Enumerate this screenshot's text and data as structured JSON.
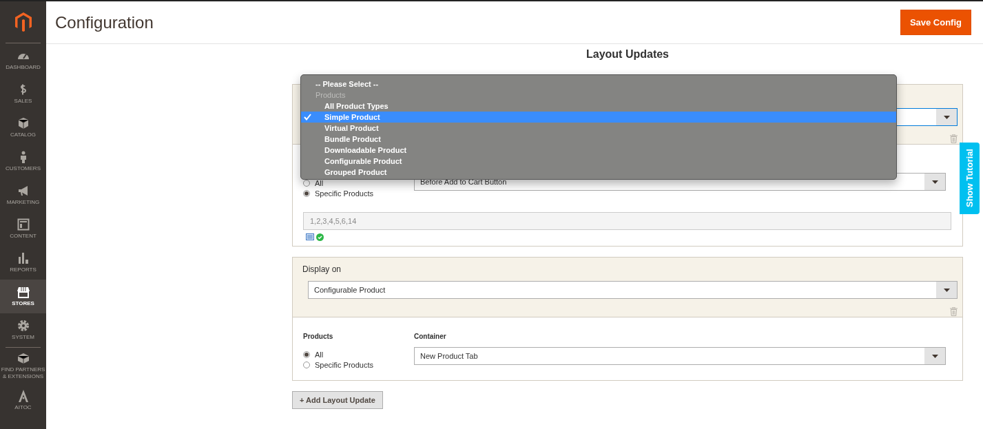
{
  "sidebar": {
    "items": [
      {
        "label": "DASHBOARD",
        "selected": false
      },
      {
        "label": "SALES",
        "selected": false
      },
      {
        "label": "CATALOG",
        "selected": false
      },
      {
        "label": "CUSTOMERS",
        "selected": false
      },
      {
        "label": "MARKETING",
        "selected": false
      },
      {
        "label": "CONTENT",
        "selected": false
      },
      {
        "label": "REPORTS",
        "selected": false
      },
      {
        "label": "STORES",
        "selected": true
      },
      {
        "label": "SYSTEM",
        "selected": false
      },
      {
        "label": "FIND PARTNERS & EXTENSIONS",
        "selected": false
      },
      {
        "label": "AITOC",
        "selected": false
      }
    ]
  },
  "header": {
    "title": "Configuration",
    "save_button": "Save Config"
  },
  "section_title": "Layout Updates",
  "layout_updates": [
    {
      "display_on": {
        "focused": true
      },
      "products": {
        "options": [
          {
            "label": "All",
            "selected": false
          },
          {
            "label": "Specific Products",
            "selected": true
          }
        ]
      },
      "container": {
        "value": "Before Add to Cart Button"
      },
      "product_ids": "1,2,3,4,5,6,14"
    },
    {
      "display_on": {
        "label": "Display on",
        "value": "Configurable Product",
        "focused": false
      },
      "products": {
        "label": "Products",
        "options": [
          {
            "label": "All",
            "selected": true
          },
          {
            "label": "Specific Products",
            "selected": false
          }
        ]
      },
      "container": {
        "label": "Container",
        "value": "New Product Tab"
      }
    }
  ],
  "dropdown_menu": {
    "items": [
      {
        "kind": "placeholder",
        "label": "-- Please Select --",
        "selected": false
      },
      {
        "kind": "group",
        "label": "Products",
        "selected": false
      },
      {
        "kind": "option",
        "label": "All Product Types",
        "selected": false
      },
      {
        "kind": "option",
        "label": "Simple Product",
        "selected": true
      },
      {
        "kind": "option",
        "label": "Virtual Product",
        "selected": false
      },
      {
        "kind": "option",
        "label": "Bundle Product",
        "selected": false
      },
      {
        "kind": "option",
        "label": "Downloadable Product",
        "selected": false
      },
      {
        "kind": "option",
        "label": "Configurable Product",
        "selected": false
      },
      {
        "kind": "option",
        "label": "Grouped Product",
        "selected": false
      }
    ]
  },
  "add_button": "+ Add Layout Update",
  "tutorial_tab": "Show Tutorial"
}
